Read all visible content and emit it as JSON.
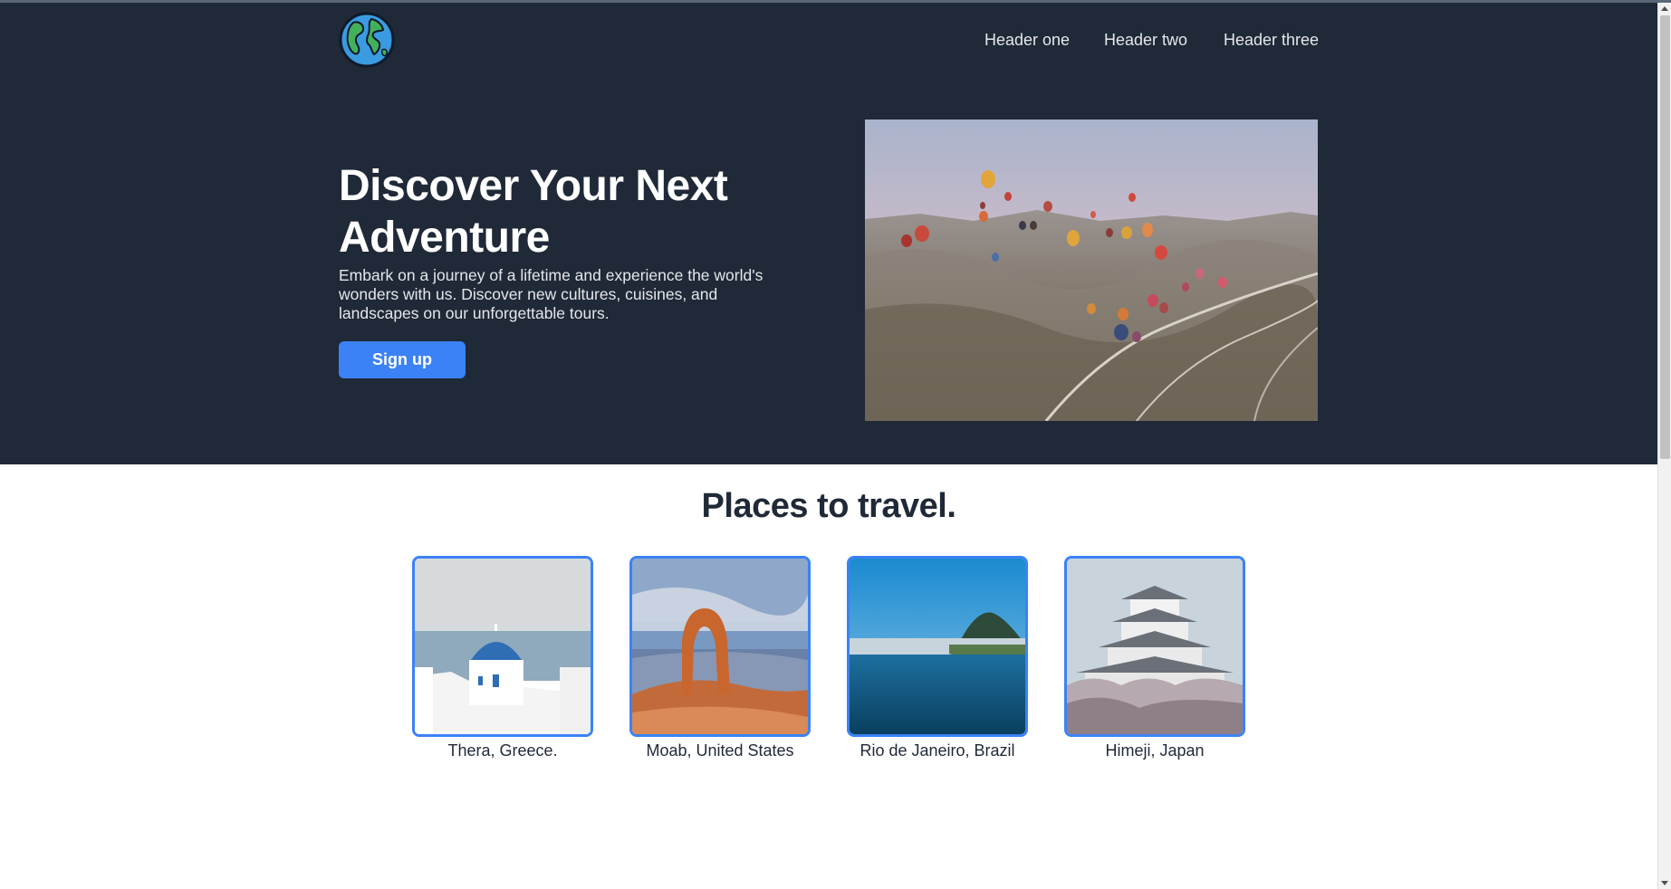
{
  "header": {
    "logo_icon": "globe-icon",
    "nav": [
      "Header one",
      "Header two",
      "Header three"
    ]
  },
  "hero": {
    "title": "Discover Your Next Adventure",
    "text": "Embark on a journey of a lifetime and experience the world's wonders with us. Discover new cultures, cuisines, and landscapes on our unforgettable tours.",
    "button_label": "Sign up",
    "image_icon": "hot-air-balloons-photo"
  },
  "places": {
    "title": "Places to travel.",
    "items": [
      {
        "label": "Thera, Greece.",
        "image_icon": "santorini-church-photo"
      },
      {
        "label": "Moab, United States",
        "image_icon": "delicate-arch-photo"
      },
      {
        "label": "Rio de Janeiro, Brazil",
        "image_icon": "rio-lagoon-photo"
      },
      {
        "label": "Himeji, Japan",
        "image_icon": "himeji-castle-photo"
      }
    ]
  },
  "colors": {
    "hero_bg": "#1f2937",
    "accent": "#3b82f6",
    "text_dark": "#1f2937"
  }
}
